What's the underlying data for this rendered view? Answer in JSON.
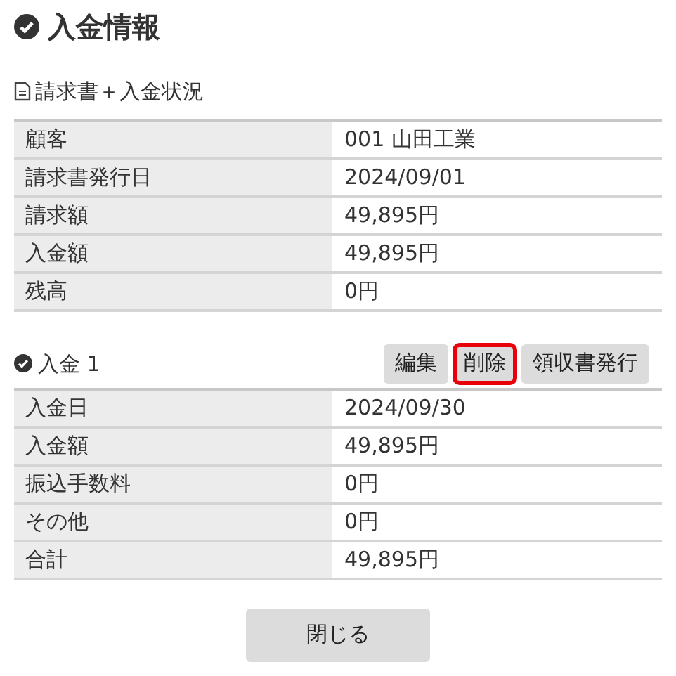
{
  "title": "入金情報",
  "invoice": {
    "heading": "請求書＋入金状況",
    "rows": [
      {
        "label": "顧客",
        "value": "001 山田工業"
      },
      {
        "label": "請求書発行日",
        "value": "2024/09/01"
      },
      {
        "label": "請求額",
        "value": "49,895円"
      },
      {
        "label": "入金額",
        "value": "49,895円"
      },
      {
        "label": "残高",
        "value": "0円"
      }
    ]
  },
  "payment": {
    "heading": "入金 1",
    "buttons": [
      {
        "label": "編集",
        "highlighted": false
      },
      {
        "label": "削除",
        "highlighted": true
      },
      {
        "label": "領収書発行",
        "highlighted": false
      }
    ],
    "rows": [
      {
        "label": "入金日",
        "value": "2024/09/30"
      },
      {
        "label": "入金額",
        "value": "49,895円"
      },
      {
        "label": "振込手数料",
        "value": "0円"
      },
      {
        "label": "その他",
        "value": "0円"
      },
      {
        "label": "合計",
        "value": "49,895円"
      }
    ]
  },
  "close_button": "閉じる"
}
